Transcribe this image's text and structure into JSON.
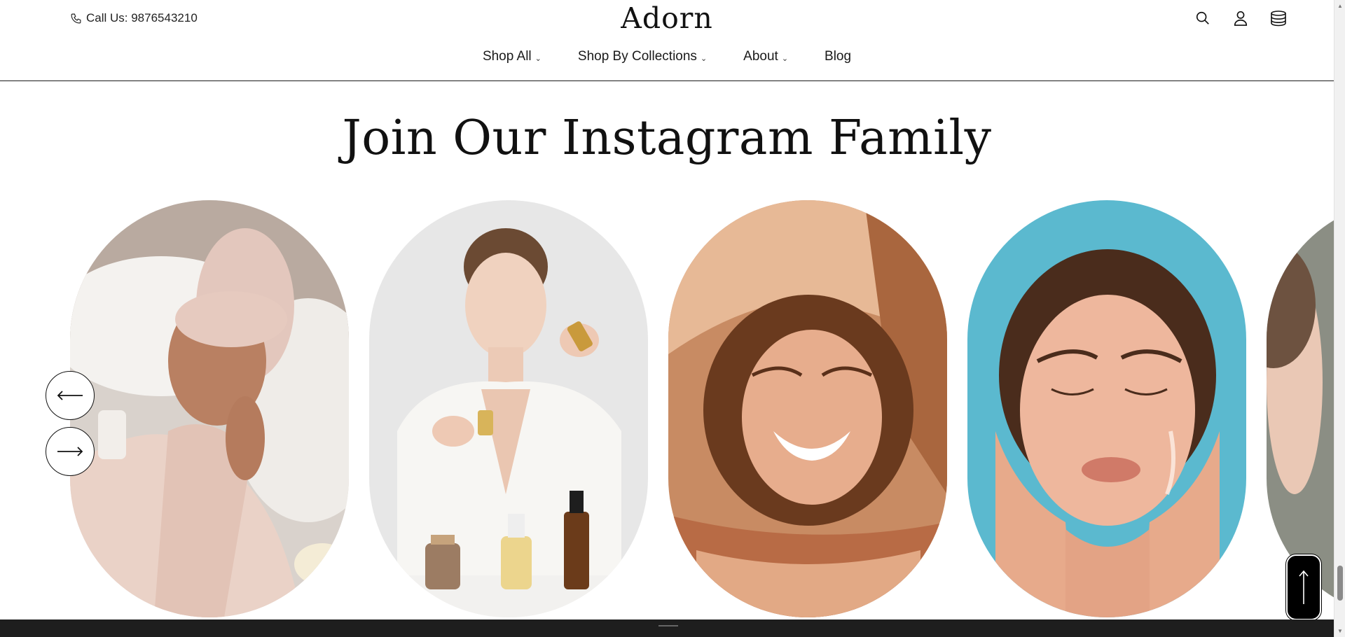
{
  "header": {
    "call_text": "Call Us: 9876543210",
    "logo": "Adorn",
    "nav": [
      {
        "label": "Shop All",
        "has_dropdown": true
      },
      {
        "label": "Shop By Collections",
        "has_dropdown": true
      },
      {
        "label": "About",
        "has_dropdown": true
      },
      {
        "label": "Blog",
        "has_dropdown": false
      }
    ],
    "icons": [
      "search-icon",
      "account-icon",
      "cart-icon"
    ]
  },
  "section": {
    "title": "Join Our Instagram Family"
  },
  "carousel": {
    "prev_icon": "arrow-left-icon",
    "next_icon": "arrow-right-icon",
    "cards": [
      {
        "name": "instagram-post-towel-wrap"
      },
      {
        "name": "instagram-post-serum-bottles"
      },
      {
        "name": "instagram-post-smiling-woman"
      },
      {
        "name": "instagram-post-glowing-skin"
      },
      {
        "name": "instagram-post-partial"
      }
    ]
  },
  "back_to_top_icon": "arrow-up-icon",
  "colors": {
    "background": "#ffffff",
    "text": "#111111",
    "footer": "#1e1e1e",
    "card_blue": "#5bb9cf"
  }
}
